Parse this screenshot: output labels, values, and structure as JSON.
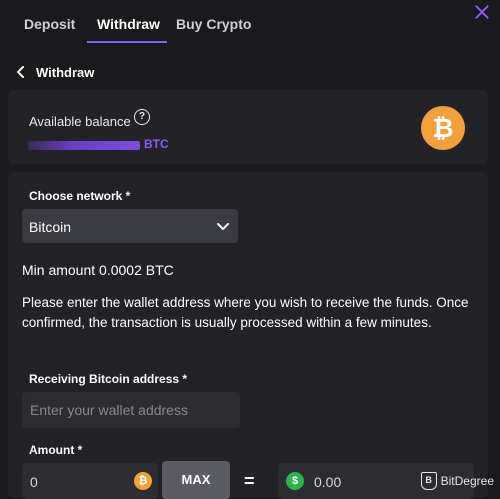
{
  "tabs": [
    {
      "label": "Deposit",
      "active": false
    },
    {
      "label": "Withdraw",
      "active": true
    },
    {
      "label": "Buy Crypto",
      "active": false
    }
  ],
  "header": {
    "title": "Withdraw"
  },
  "balance": {
    "label": "Available balance",
    "help_icon_text": "?",
    "currency": "BTC",
    "coin_symbol": "₿",
    "icon": "bitcoin-icon"
  },
  "form": {
    "network_label": "Choose network *",
    "network_value": "Bitcoin",
    "min_amount": "Min amount 0.0002 BTC",
    "info_text": "Please enter the wallet address where you wish to receive the funds. Once confirmed, the transaction is usually processed within a few minutes.",
    "address_label": "Receiving Bitcoin address *",
    "address_placeholder": "Enter your wallet address",
    "amount_label": "Amount *",
    "amount_value": "0",
    "btc_coin_symbol": "₿",
    "max_label": "MAX",
    "equals": "=",
    "fiat_coin_symbol": "$",
    "fiat_value": "0.00"
  },
  "watermark": {
    "logo": "B",
    "text": "BitDegree"
  },
  "colors": {
    "accent": "#8b5cf6",
    "bitcoin": "#f2a03b",
    "usd": "#2fb24c",
    "background": "#1a1a1c",
    "card": "#232327"
  }
}
